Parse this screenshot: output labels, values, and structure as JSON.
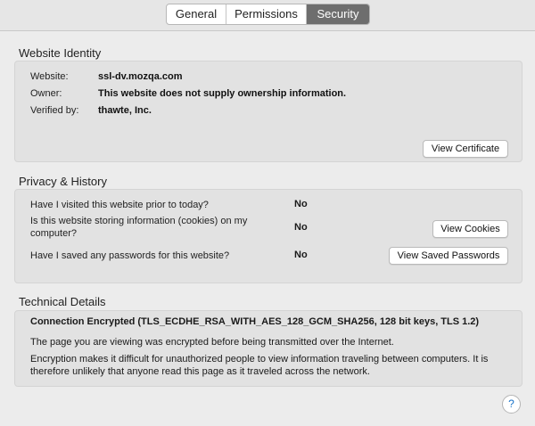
{
  "tabs": [
    {
      "label": "General"
    },
    {
      "label": "Permissions"
    },
    {
      "label": "Security"
    }
  ],
  "identity": {
    "title": "Website Identity",
    "rows": [
      {
        "label": "Website:",
        "value": "ssl-dv.mozqa.com"
      },
      {
        "label": "Owner:",
        "value": "This website does not supply ownership information."
      },
      {
        "label": "Verified by:",
        "value": "thawte, Inc."
      }
    ],
    "button": "View Certificate"
  },
  "privacy": {
    "title": "Privacy & History",
    "rows": [
      {
        "question": "Have I visited this website prior to today?",
        "answer": "No"
      },
      {
        "question": "Is this website storing information (cookies) on my computer?",
        "answer": "No",
        "button": "View Cookies"
      },
      {
        "question": "Have I saved any passwords for this website?",
        "answer": "No",
        "button": "View Saved Passwords"
      }
    ]
  },
  "technical": {
    "title": "Technical Details",
    "heading": "Connection Encrypted (TLS_ECDHE_RSA_WITH_AES_128_GCM_SHA256, 128 bit keys, TLS 1.2)",
    "para1": "The page you are viewing was encrypted before being transmitted over the Internet.",
    "para2": "Encryption makes it difficult for unauthorized people to view information traveling between computers. It is therefore unlikely that anyone read this page as it traveled across the network."
  },
  "help": {
    "label": "?",
    "icon": "help-icon"
  }
}
